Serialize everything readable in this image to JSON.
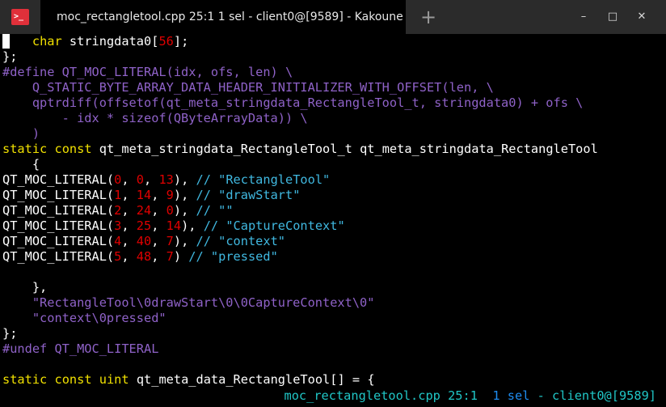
{
  "window": {
    "tab_title": "moc_rectangletool.cpp 25:1  1 sel - client0@[9589] - Kakoune",
    "app_icon_glyph": ">_",
    "new_tab_glyph": "+",
    "minimize_glyph": "–",
    "maximize_glyph": "□",
    "close_glyph": "✕"
  },
  "code_lines": [
    [
      {
        "t": " ",
        "c": "cursor"
      },
      {
        "t": "   "
      },
      {
        "t": "char",
        "c": "kw"
      },
      {
        "t": " stringdata0["
      },
      {
        "t": "56",
        "c": "num"
      },
      {
        "t": "];"
      }
    ],
    [
      {
        "t": "};"
      }
    ],
    [
      {
        "t": "#define QT_MOC_LITERAL(idx, ofs, len) \\",
        "c": "pp"
      }
    ],
    [
      {
        "t": "    Q_STATIC_BYTE_ARRAY_DATA_HEADER_INITIALIZER_WITH_OFFSET(len, \\",
        "c": "pp"
      }
    ],
    [
      {
        "t": "    qptrdiff(offsetof(qt_meta_stringdata_RectangleTool_t, stringdata0) + ofs \\",
        "c": "pp"
      }
    ],
    [
      {
        "t": "        - idx * sizeof(QByteArrayData)) \\",
        "c": "pp"
      }
    ],
    [
      {
        "t": "    )",
        "c": "pp"
      }
    ],
    [
      {
        "t": "static",
        "c": "kw"
      },
      {
        "t": " "
      },
      {
        "t": "const",
        "c": "kw"
      },
      {
        "t": " qt_meta_stringdata_RectangleTool_t qt_meta_stringdata_RectangleTool"
      }
    ],
    [
      {
        "t": "    {"
      }
    ],
    [
      {
        "t": "QT_MOC_LITERAL("
      },
      {
        "t": "0",
        "c": "num"
      },
      {
        "t": ", "
      },
      {
        "t": "0",
        "c": "num"
      },
      {
        "t": ", "
      },
      {
        "t": "13",
        "c": "num"
      },
      {
        "t": "), "
      },
      {
        "t": "// \"RectangleTool\"",
        "c": "str"
      }
    ],
    [
      {
        "t": "QT_MOC_LITERAL("
      },
      {
        "t": "1",
        "c": "num"
      },
      {
        "t": ", "
      },
      {
        "t": "14",
        "c": "num"
      },
      {
        "t": ", "
      },
      {
        "t": "9",
        "c": "num"
      },
      {
        "t": "), "
      },
      {
        "t": "// \"drawStart\"",
        "c": "str"
      }
    ],
    [
      {
        "t": "QT_MOC_LITERAL("
      },
      {
        "t": "2",
        "c": "num"
      },
      {
        "t": ", "
      },
      {
        "t": "24",
        "c": "num"
      },
      {
        "t": ", "
      },
      {
        "t": "0",
        "c": "num"
      },
      {
        "t": "), "
      },
      {
        "t": "// \"\"",
        "c": "str"
      }
    ],
    [
      {
        "t": "QT_MOC_LITERAL("
      },
      {
        "t": "3",
        "c": "num"
      },
      {
        "t": ", "
      },
      {
        "t": "25",
        "c": "num"
      },
      {
        "t": ", "
      },
      {
        "t": "14",
        "c": "num"
      },
      {
        "t": "), "
      },
      {
        "t": "// \"CaptureContext\"",
        "c": "str"
      }
    ],
    [
      {
        "t": "QT_MOC_LITERAL("
      },
      {
        "t": "4",
        "c": "num"
      },
      {
        "t": ", "
      },
      {
        "t": "40",
        "c": "num"
      },
      {
        "t": ", "
      },
      {
        "t": "7",
        "c": "num"
      },
      {
        "t": "), "
      },
      {
        "t": "// \"context\"",
        "c": "str"
      }
    ],
    [
      {
        "t": "QT_MOC_LITERAL("
      },
      {
        "t": "5",
        "c": "num"
      },
      {
        "t": ", "
      },
      {
        "t": "48",
        "c": "num"
      },
      {
        "t": ", "
      },
      {
        "t": "7",
        "c": "num"
      },
      {
        "t": ") "
      },
      {
        "t": "// \"pressed\"",
        "c": "str"
      }
    ],
    [
      {
        "t": ""
      }
    ],
    [
      {
        "t": "    },"
      }
    ],
    [
      {
        "t": "    \"RectangleTool\\0drawStart\\0\\0CaptureContext\\0\"",
        "c": "pp"
      }
    ],
    [
      {
        "t": "    \"context\\0pressed\"",
        "c": "pp"
      }
    ],
    [
      {
        "t": "};"
      }
    ],
    [
      {
        "t": "#undef QT_MOC_LITERAL",
        "c": "pp"
      }
    ],
    [
      {
        "t": ""
      }
    ],
    [
      {
        "t": "static",
        "c": "kw"
      },
      {
        "t": " "
      },
      {
        "t": "const",
        "c": "kw"
      },
      {
        "t": " "
      },
      {
        "t": "uint",
        "c": "kw"
      },
      {
        "t": " qt_meta_data_RectangleTool[] = {"
      }
    ]
  ],
  "status": {
    "file_pos": "moc_rectangletool.cpp 25:1",
    "selection": "1 sel",
    "client": "- client0@[9589]"
  }
}
